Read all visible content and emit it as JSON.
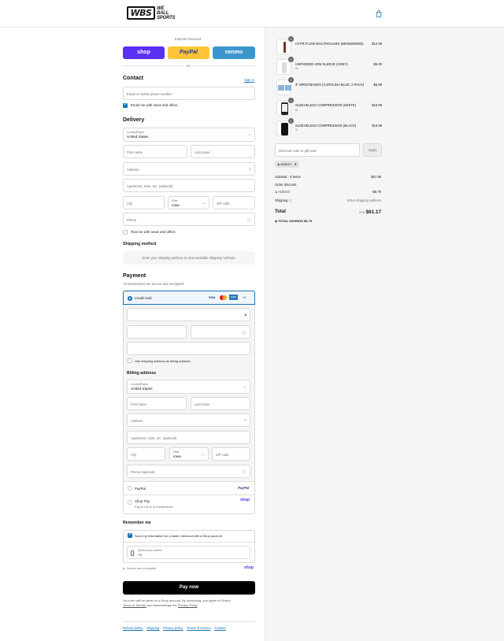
{
  "header": {
    "logo_mark": "WBS",
    "logo_line1": "WE",
    "logo_line2": "BALL",
    "logo_line3": "SPORTS",
    "cart_icon": "shopping-bag-icon"
  },
  "express": {
    "title": "Express checkout",
    "shop": "shop",
    "paypal": "PayPal",
    "venmo": "venmo",
    "or": "OR",
    "colors": {
      "shop": "#5a31f4",
      "paypal": "#ffc439",
      "venmo": "#3d95ce"
    }
  },
  "contact": {
    "title": "Contact",
    "signin": "Sign in",
    "email_placeholder": "Email or mobile phone number",
    "news_label": "Email me with news and offers"
  },
  "delivery": {
    "title": "Delivery",
    "country_label": "Country/Region",
    "country_value": "United States",
    "first_name": "First name",
    "last_name": "Last name",
    "address": "Address",
    "apartment": "Apartment, suite, etc. (optional)",
    "city": "City",
    "state_label": "State",
    "state_value": "Iowa",
    "zip": "ZIP code",
    "phone": "Phone",
    "text_news": "Text me with news and offers"
  },
  "shipping": {
    "title": "Shipping method",
    "message": "Enter your shipping address to view available shipping methods."
  },
  "payment": {
    "title": "Payment",
    "subtitle": "All transactions are secure and encrypted.",
    "credit_card": "Credit card",
    "cards": [
      "VISA",
      "MC",
      "AMEX",
      "+4"
    ],
    "use_shipping": "Use shipping address as billing address",
    "paypal_label": "PayPal",
    "paypal_logo": "PayPal",
    "shoppay_label": "Shop Pay",
    "shoppay_sub": "Pay in full or in installments",
    "shoppay_logo": "shop"
  },
  "billing": {
    "title": "Billing address",
    "country_label": "Country/Region",
    "country_value": "United States",
    "first_name": "First name",
    "last_name": "Last name",
    "address": "Address",
    "apartment": "Apartment, suite, etc. (optional)",
    "city": "City",
    "state_label": "State",
    "state_value": "Iowa",
    "zip": "ZIP code",
    "phone": "Phone (optional)"
  },
  "remember": {
    "title": "Remember me",
    "save_label": "Save my information for a faster checkout with a Shop account",
    "mobile_label": "Mobile phone number",
    "mobile_value": "+1",
    "secure": "Secure and encrypted",
    "shop_logo": "shop"
  },
  "pay_button": "Pay now",
  "terms": {
    "line1": "Your info will be saved to a Shop account. By continuing, you agree to Shop's",
    "terms_link": "Terms of Service",
    "line2": "and acknowledge the",
    "privacy_link": "Privacy Policy"
  },
  "footer": [
    "Refund policy",
    "Shipping",
    "Privacy policy",
    "Terms of service",
    "Contact"
  ],
  "cart": {
    "items": [
      {
        "qty": "1",
        "name": "HYPR.FLOW MOUTHGUARD (BROWN/RED)",
        "variant": "",
        "price": "$12.99"
      },
      {
        "qty": "1",
        "name": "UNPADDED ARM SLEEVE (GREY)",
        "variant": "XL",
        "price": "$5.00"
      },
      {
        "qty": "1",
        "name": "3\" WRISTBANDS (CAROLINA BLUE, 2-PACK)",
        "variant": "",
        "price": "$6.99"
      },
      {
        "qty": "1",
        "name": "SLEEVELESS COMPRESSION (WHITE)",
        "variant": "M",
        "price": "$19.99"
      },
      {
        "qty": "1",
        "name": "SLEEVELESS COMPRESSION (BLACK)",
        "variant": "S",
        "price": "$19.99"
      }
    ],
    "discount_placeholder": "Discount code or gift card",
    "apply": "Apply",
    "code": "ADBGO",
    "subtotal_label": "Subtotal · 5 items",
    "subtotal_value": "$67.96",
    "order_discount": "Order discount",
    "discount_code": "ADBGO",
    "discount_value": "- $6.79",
    "shipping_label": "Shipping",
    "shipping_value": "Enter shipping address",
    "total_label": "Total",
    "currency": "USD",
    "total_value": "$61.17",
    "savings_label": "TOTAL SAVINGS",
    "savings_value": "$6.79"
  }
}
